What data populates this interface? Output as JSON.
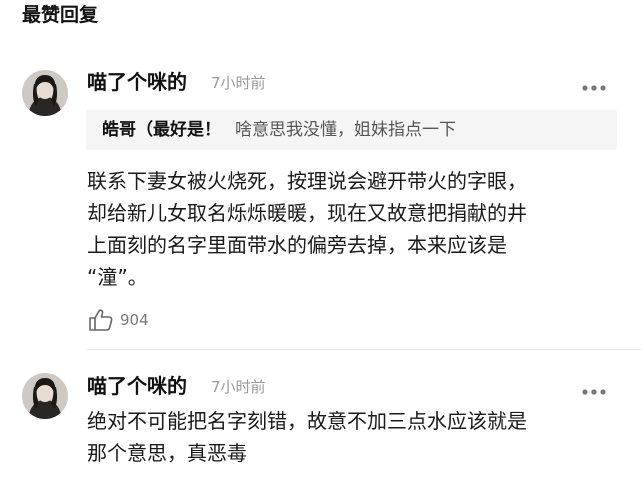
{
  "section": {
    "title": "最赞回复"
  },
  "comments": [
    {
      "username": "喵了个咪的",
      "time": "7小时前",
      "reply_to": {
        "author": "皓哥（最好是！",
        "text": "啥意思我没懂，姐妹指点一下"
      },
      "body_lines": [
        "联系下妻女被火烧死，按理说会避开带火的字眼，",
        "却给新儿女取名烁烁暖暖，现在又故意把捐献的井",
        "上面刻的名字里面带水的偏旁去掉，本来应该是",
        "“潼”。"
      ],
      "likes": "904",
      "icons": {
        "more": "more-dots-icon",
        "like": "thumbs-up-icon"
      }
    },
    {
      "username": "喵了个咪的",
      "time": "7小时前",
      "body_lines": [
        "绝对不可能把名字刻错，故意不加三点水应该就是",
        "那个意思，真恶毒"
      ],
      "icons": {
        "more": "more-dots-icon"
      }
    }
  ],
  "colors": {
    "meta_text": "#9a9a9a",
    "quote_bg": "#f5f5f5",
    "divider": "#e6e6e6"
  }
}
